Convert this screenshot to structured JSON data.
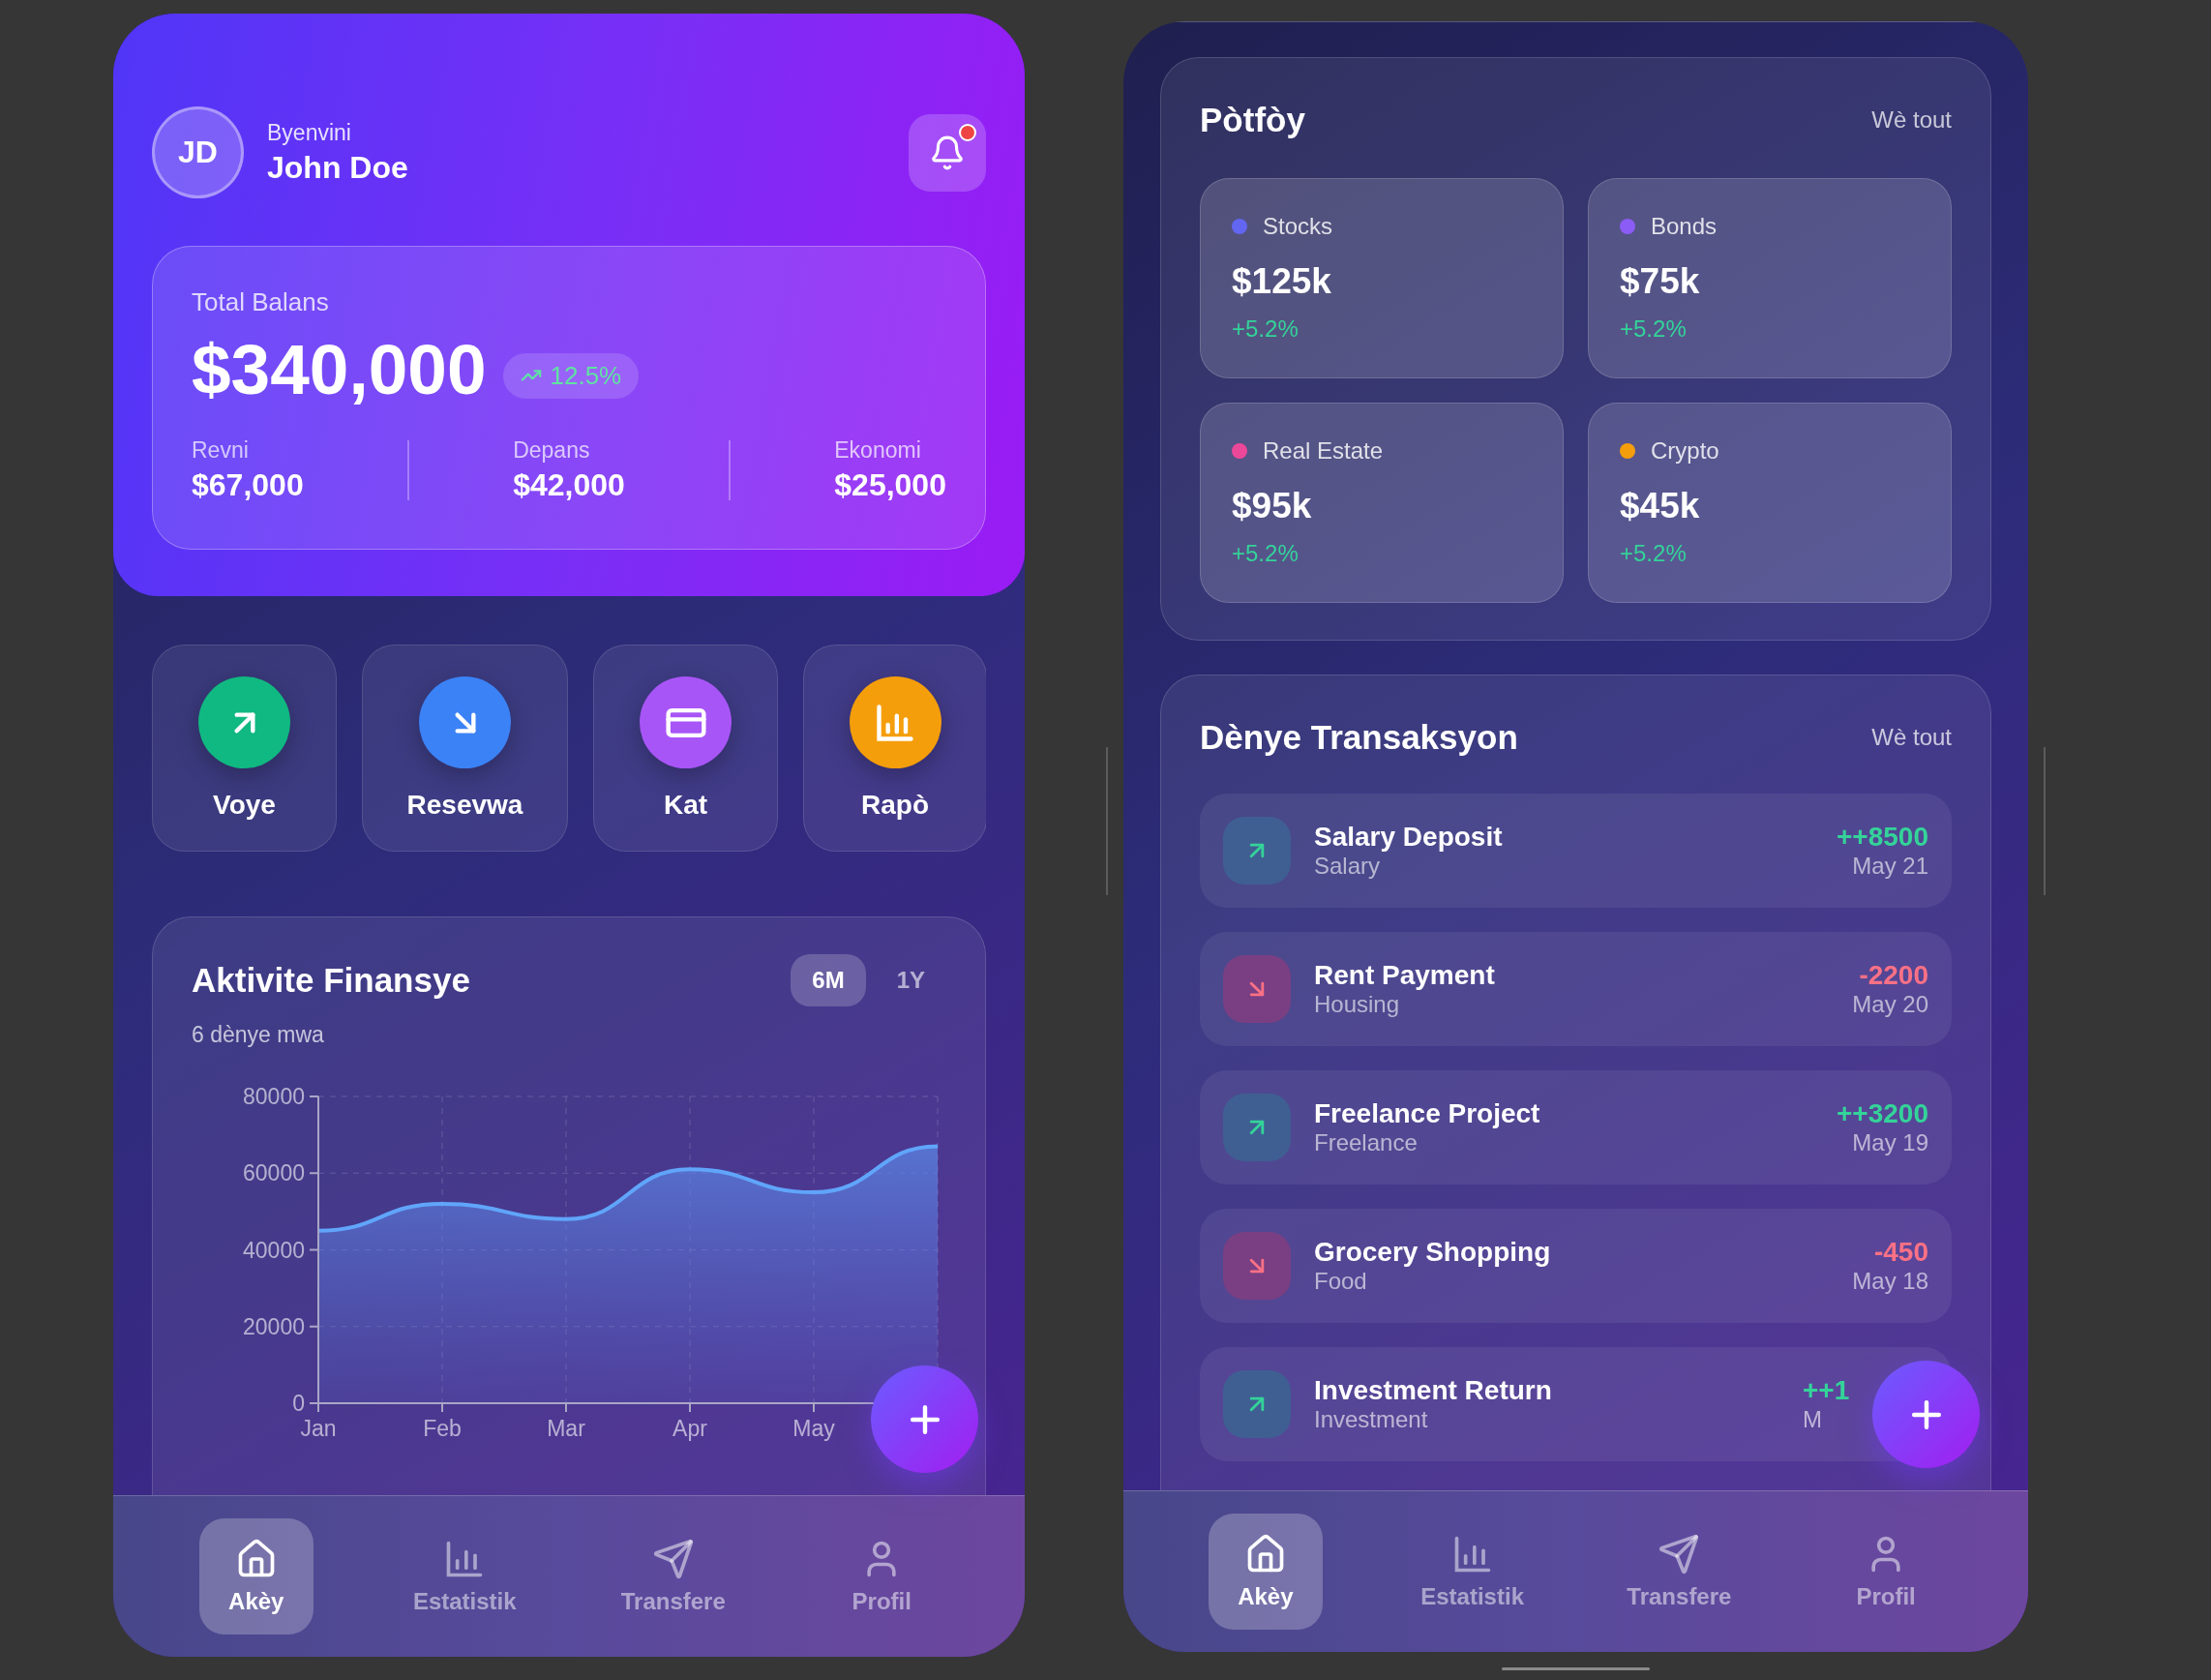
{
  "home_screen": {
    "avatar_initials": "JD",
    "greeting": "Byenvini",
    "user_name": "John Doe",
    "notification": {
      "unread": true
    },
    "balance": {
      "label": "Total Balans",
      "amount": "$340,000",
      "change": "12.5%",
      "stats": [
        {
          "label": "Revni",
          "value": "$67,000"
        },
        {
          "label": "Depans",
          "value": "$42,000"
        },
        {
          "label": "Ekonomi",
          "value": "$25,000"
        }
      ]
    },
    "quick_actions": [
      {
        "label": "Voye",
        "color": "#10b981"
      },
      {
        "label": "Resevwa",
        "color": "#3b82f6"
      },
      {
        "label": "Kat",
        "color": "#a855f7"
      },
      {
        "label": "Rapò",
        "color": "#f59e0b"
      }
    ],
    "activity": {
      "title": "Aktivite Finansye",
      "subtitle": "6 dènye mwa",
      "ranges": [
        {
          "label": "6M",
          "selected": true
        },
        {
          "label": "1Y",
          "selected": false
        }
      ],
      "chart_data": {
        "type": "area",
        "grid": true,
        "categories": [
          "Jan",
          "Feb",
          "Mar",
          "Apr",
          "May",
          null
        ],
        "ylim": [
          0,
          80000
        ],
        "yticks": [
          0,
          20000,
          40000,
          60000,
          80000
        ],
        "series": [
          {
            "color": "#60a5fa",
            "values": [
              45000,
              52000,
              48000,
              61000,
              55000,
              67000
            ]
          }
        ]
      }
    },
    "nav": [
      {
        "label": "Akèy",
        "selected": true
      },
      {
        "label": "Estatistik",
        "selected": false
      },
      {
        "label": "Transfere",
        "selected": false
      },
      {
        "label": "Profil",
        "selected": false
      }
    ]
  },
  "portfolio_screen": {
    "portfolio": {
      "title": "Pòtfòy",
      "link": "Wè tout",
      "assets": [
        {
          "label": "Stocks",
          "value": "$125k",
          "change": "+5.2%",
          "color": "#6366f1"
        },
        {
          "label": "Bonds",
          "value": "$75k",
          "change": "+5.2%",
          "color": "#8b5cf6"
        },
        {
          "label": "Real Estate",
          "value": "$95k",
          "change": "+5.2%",
          "color": "#ec4899"
        },
        {
          "label": "Crypto",
          "value": "$45k",
          "change": "+5.2%",
          "color": "#f59e0b"
        }
      ]
    },
    "transactions": {
      "title": "Dènye Transaksyon",
      "link": "Wè tout",
      "items": [
        {
          "title": "Salary Deposit",
          "category": "Salary",
          "amount": "++8500",
          "date": "May 21",
          "kind": "credit",
          "cut": false
        },
        {
          "title": "Rent Payment",
          "category": "Housing",
          "amount": "-2200",
          "date": "May 20",
          "kind": "debit",
          "cut": false
        },
        {
          "title": "Freelance Project",
          "category": "Freelance",
          "amount": "++3200",
          "date": "May 19",
          "kind": "credit",
          "cut": false
        },
        {
          "title": "Grocery Shopping",
          "category": "Food",
          "amount": "-450",
          "date": "May 18",
          "kind": "debit",
          "cut": false
        },
        {
          "title": "Investment Return",
          "category": "Investment",
          "amount": "++1",
          "date": "M",
          "kind": "credit",
          "cut": true
        }
      ]
    },
    "nav": [
      {
        "label": "Akèy",
        "selected": true
      },
      {
        "label": "Estatistik",
        "selected": false
      },
      {
        "label": "Transfere",
        "selected": false
      },
      {
        "label": "Profil",
        "selected": false
      }
    ]
  }
}
